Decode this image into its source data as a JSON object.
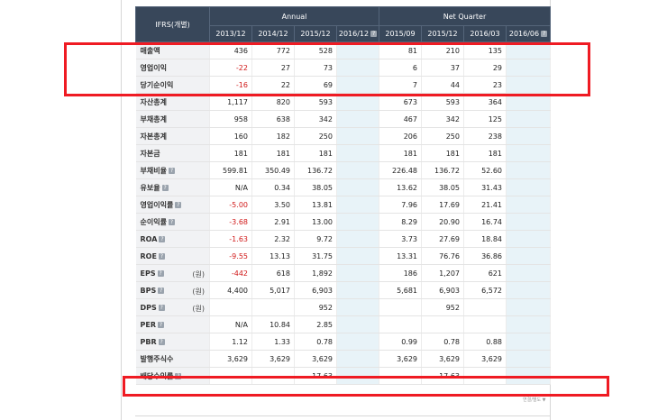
{
  "table": {
    "header_label": "IFRS(개별)",
    "groups": {
      "annual": "Annual",
      "net_quarter": "Net Quarter"
    },
    "annual_periods": [
      "2013/12",
      "2014/12",
      "2015/12",
      "2016/12"
    ],
    "quarter_periods": [
      "2015/09",
      "2015/12",
      "2016/03",
      "2016/06"
    ],
    "rows": [
      {
        "label": "매출액",
        "help": false,
        "unit": "",
        "values": [
          "436",
          "772",
          "528",
          "",
          "81",
          "210",
          "135",
          ""
        ]
      },
      {
        "label": "영업이익",
        "help": false,
        "unit": "",
        "values": [
          "-22",
          "27",
          "73",
          "",
          "6",
          "37",
          "29",
          ""
        ]
      },
      {
        "label": "당기순이익",
        "help": false,
        "unit": "",
        "values": [
          "-16",
          "22",
          "69",
          "",
          "7",
          "44",
          "23",
          ""
        ]
      },
      {
        "label": "자산총계",
        "help": false,
        "unit": "",
        "values": [
          "1,117",
          "820",
          "593",
          "",
          "673",
          "593",
          "364",
          ""
        ]
      },
      {
        "label": "부채총계",
        "help": false,
        "unit": "",
        "values": [
          "958",
          "638",
          "342",
          "",
          "467",
          "342",
          "125",
          ""
        ]
      },
      {
        "label": "자본총계",
        "help": false,
        "unit": "",
        "values": [
          "160",
          "182",
          "250",
          "",
          "206",
          "250",
          "238",
          ""
        ]
      },
      {
        "label": "자본금",
        "help": false,
        "unit": "",
        "values": [
          "181",
          "181",
          "181",
          "",
          "181",
          "181",
          "181",
          ""
        ]
      },
      {
        "label": "부채비율",
        "help": true,
        "unit": "",
        "values": [
          "599.81",
          "350.49",
          "136.72",
          "",
          "226.48",
          "136.72",
          "52.60",
          ""
        ]
      },
      {
        "label": "유보율",
        "help": true,
        "unit": "",
        "values": [
          "N/A",
          "0.34",
          "38.05",
          "",
          "13.62",
          "38.05",
          "31.43",
          ""
        ]
      },
      {
        "label": "영업이익률",
        "help": true,
        "unit": "",
        "values": [
          "-5.00",
          "3.50",
          "13.81",
          "",
          "7.96",
          "17.69",
          "21.41",
          ""
        ]
      },
      {
        "label": "순이익률",
        "help": true,
        "unit": "",
        "values": [
          "-3.68",
          "2.91",
          "13.00",
          "",
          "8.29",
          "20.90",
          "16.74",
          ""
        ]
      },
      {
        "label": "ROA",
        "help": true,
        "unit": "",
        "values": [
          "-1.63",
          "2.32",
          "9.72",
          "",
          "3.73",
          "27.69",
          "18.84",
          ""
        ]
      },
      {
        "label": "ROE",
        "help": true,
        "unit": "",
        "values": [
          "-9.55",
          "13.13",
          "31.75",
          "",
          "13.31",
          "76.76",
          "36.86",
          ""
        ]
      },
      {
        "label": "EPS",
        "help": true,
        "unit": "(원)",
        "values": [
          "-442",
          "618",
          "1,892",
          "",
          "186",
          "1,207",
          "621",
          ""
        ]
      },
      {
        "label": "BPS",
        "help": true,
        "unit": "(원)",
        "values": [
          "4,400",
          "5,017",
          "6,903",
          "",
          "5,681",
          "6,903",
          "6,572",
          ""
        ]
      },
      {
        "label": "DPS",
        "help": true,
        "unit": "(원)",
        "values": [
          "",
          "",
          "952",
          "",
          "",
          "952",
          "",
          ""
        ]
      },
      {
        "label": "PER",
        "help": true,
        "unit": "",
        "values": [
          "N/A",
          "10.84",
          "2.85",
          "",
          "",
          "",
          "",
          ""
        ]
      },
      {
        "label": "PBR",
        "help": true,
        "unit": "",
        "values": [
          "1.12",
          "1.33",
          "0.78",
          "",
          "0.99",
          "0.78",
          "0.88",
          ""
        ]
      },
      {
        "label": "발행주식수",
        "help": false,
        "unit": "",
        "values": [
          "3,629",
          "3,629",
          "3,629",
          "",
          "3,629",
          "3,629",
          "3,629",
          ""
        ]
      },
      {
        "label": "배당수익률",
        "help": true,
        "unit": "",
        "values": [
          "",
          "",
          "17.63",
          "",
          "",
          "17.63",
          "",
          ""
        ]
      }
    ],
    "footnote": "연결/별도 ▼",
    "colors": {
      "header_bg": "#38475a",
      "negative": "#d11a1a",
      "estimate_bg": "#e8f3f8",
      "highlight": "#ef1b23"
    },
    "icons": [
      "help-icon"
    ]
  }
}
